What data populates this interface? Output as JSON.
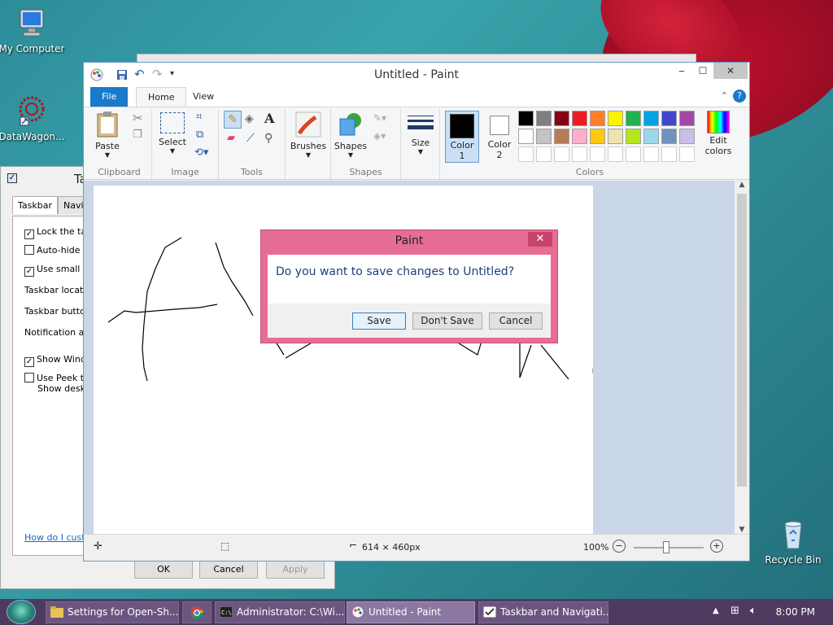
{
  "desktop": {
    "icons": [
      {
        "label": "My Computer"
      },
      {
        "label": "DataWagon..."
      },
      {
        "label": "Recycle Bin"
      }
    ]
  },
  "taskbar_settings": {
    "title": "Ta",
    "tabs": [
      "Taskbar",
      "Navig"
    ],
    "rows": [
      {
        "label": "Lock the tas",
        "checked": true
      },
      {
        "label": "Auto-hide th",
        "checked": false
      },
      {
        "label": "Use small ta",
        "checked": true
      },
      {
        "label": "Taskbar location",
        "checked": null
      },
      {
        "label": "Taskbar button",
        "checked": null
      },
      {
        "label": "Notification are",
        "checked": null
      },
      {
        "label": "Show Windo",
        "checked": true
      },
      {
        "label": "Use Peek to",
        "checked": false
      },
      {
        "label": "Show deskto",
        "checked": null
      }
    ],
    "help_link": "How do I custo",
    "buttons": {
      "ok": "OK",
      "cancel": "Cancel",
      "apply": "Apply"
    }
  },
  "paint": {
    "title": "Untitled - Paint",
    "controls": {
      "minimize": "‒",
      "maximize": "☐",
      "close": "✕"
    },
    "ribbon_tabs": {
      "file": "File",
      "home": "Home",
      "view": "View"
    },
    "groups": {
      "clipboard": "Clipboard",
      "image": "Image",
      "tools": "Tools",
      "shapes": "Shapes",
      "colors": "Colors"
    },
    "buttons": {
      "paste": "Paste",
      "select": "Select",
      "brushes": "Brushes",
      "shapes": "Shapes",
      "size": "Size",
      "color1_line1": "Color",
      "color1_line2": "1",
      "color2_line1": "Color",
      "color2_line2": "2",
      "edit_colors_line1": "Edit",
      "edit_colors_line2": "colors"
    },
    "palette_row1": [
      "#000000",
      "#7f7f7f",
      "#880015",
      "#ed1c24",
      "#ff7f27",
      "#fff200",
      "#22b14c",
      "#00a2e8",
      "#3f48cc",
      "#a349a4"
    ],
    "palette_row2": [
      "#ffffff",
      "#c3c3c3",
      "#b97a57",
      "#ffaec9",
      "#ffc90e",
      "#efe4b0",
      "#b5e61d",
      "#99d9ea",
      "#7092be",
      "#c8bfe7"
    ],
    "color1": "#000000",
    "color2": "#ffffff",
    "status": {
      "image_size": "614 × 460px",
      "zoom": "100%"
    }
  },
  "dialog": {
    "title": "Paint",
    "message": "Do you want to save changes to Untitled?",
    "save": "Save",
    "dont_save": "Don't Save",
    "cancel": "Cancel"
  },
  "taskbar": {
    "items": [
      {
        "label": "Settings for Open-Sh..."
      },
      {
        "label": "Administrator: C:\\Wi..."
      },
      {
        "label": "Untitled - Paint"
      },
      {
        "label": "Taskbar and Navigati..."
      }
    ],
    "clock": "8:00 PM"
  }
}
